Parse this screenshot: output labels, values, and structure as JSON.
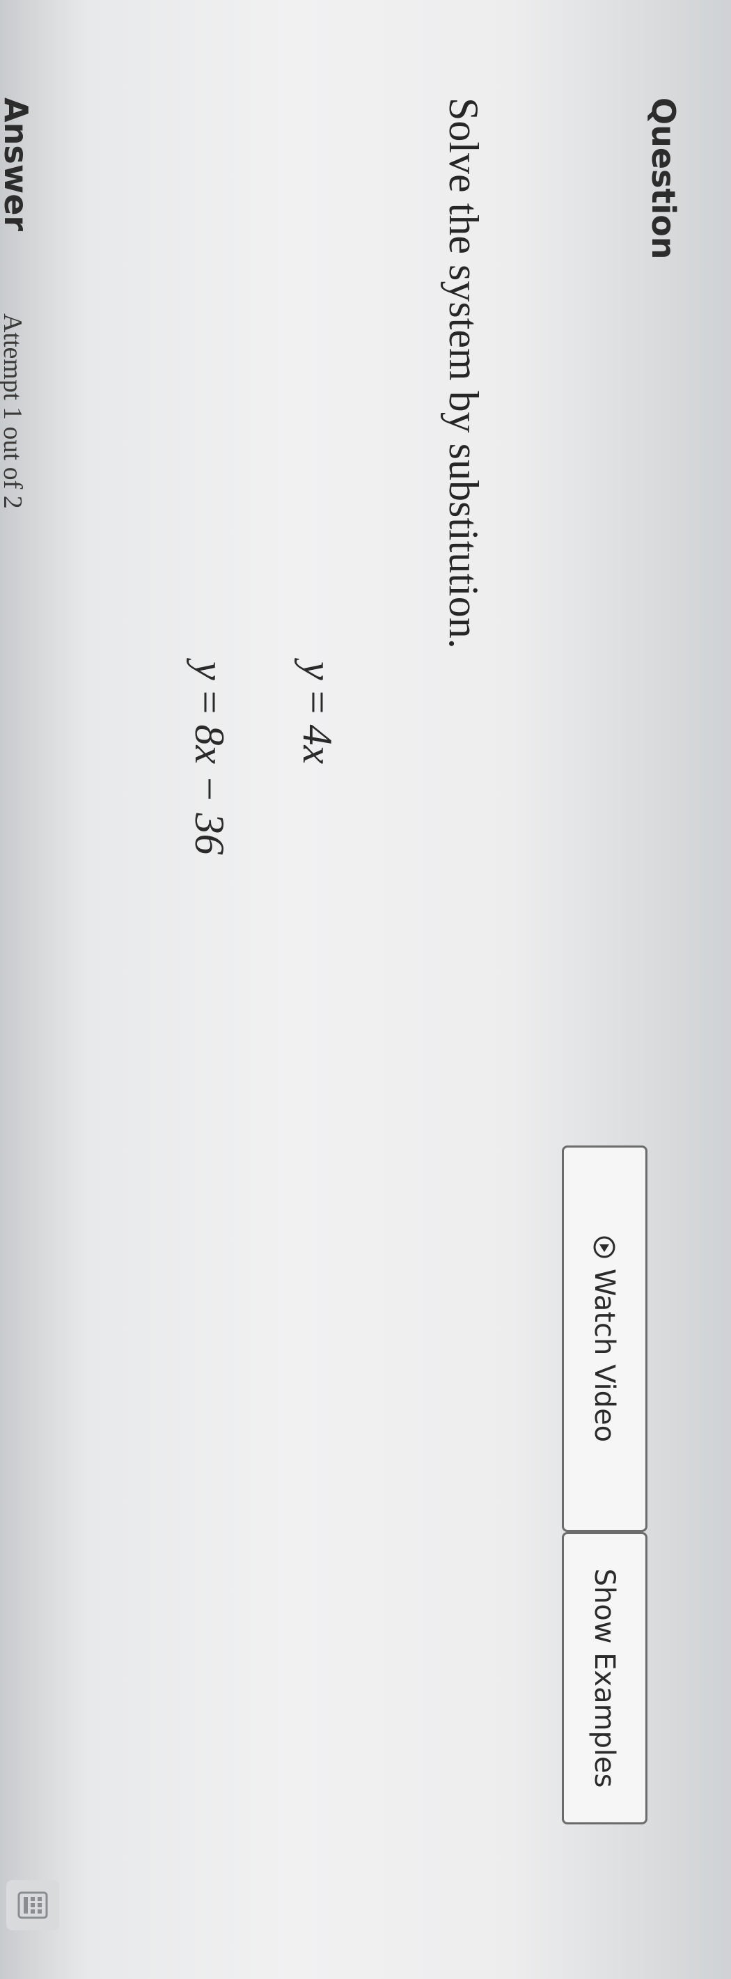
{
  "question": {
    "heading": "Question",
    "instruction": "Solve the system by substitution.",
    "equations": [
      {
        "lhs": "y",
        "op": "=",
        "rhs": "4x"
      },
      {
        "lhs": "y",
        "op": "=",
        "rhs": "8x − 36"
      }
    ]
  },
  "buttons": {
    "watch_video": "Watch Video",
    "show_examples": "Show Examples"
  },
  "answer": {
    "heading": "Answer",
    "attempt": "Attempt 1 out of 2"
  },
  "icons": {
    "play": "play-circle-icon",
    "keypad": "keypad-icon"
  },
  "colors": {
    "text": "#2a2a2a",
    "button_border": "#6b6b6b",
    "background": "#f1f1f2"
  }
}
